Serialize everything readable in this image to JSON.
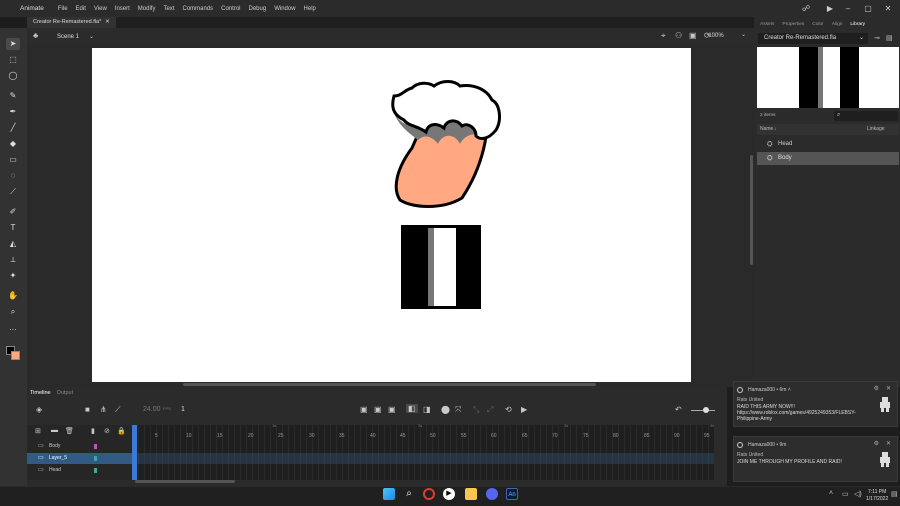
{
  "app": {
    "name": "Animate"
  },
  "menu": [
    "File",
    "Edit",
    "View",
    "Insert",
    "Modify",
    "Text",
    "Commands",
    "Control",
    "Debug",
    "Window",
    "Help"
  ],
  "document": {
    "tab_label": "Creator Re-Remastered.fla*",
    "scene": "Scene 1",
    "zoom": "100%"
  },
  "right_panel": {
    "tabs": [
      "Assets",
      "Properties",
      "Color",
      "Align",
      "Library"
    ],
    "active_tab": "Library",
    "library_file": "Creator Re-Remastered.fla",
    "items_count": "2 items",
    "col_name": "Name",
    "col_linkage": "Linkage",
    "items": [
      {
        "label": "Head",
        "selected": false
      },
      {
        "label": "Body",
        "selected": true
      }
    ]
  },
  "timeline": {
    "tabs": [
      "Timeline",
      "Output"
    ],
    "fps": "24.00",
    "fps_unit": "FPS",
    "frame": "1",
    "layers": [
      {
        "label": "Body",
        "selected": false
      },
      {
        "label": "Layer_5",
        "selected": true
      },
      {
        "label": "Head",
        "selected": false
      }
    ],
    "ruler": [
      "5",
      "10",
      "15",
      "20",
      "25",
      "30",
      "35",
      "40",
      "45",
      "50",
      "55",
      "60",
      "65",
      "70",
      "75",
      "80",
      "85",
      "90",
      "95"
    ],
    "seconds": [
      "1s",
      "2s",
      "3s",
      "4s"
    ]
  },
  "notifications": [
    {
      "user": "Hamaza000",
      "time": "6m",
      "title": "Rats United",
      "message": "RAID THIS ARMY NOW!!! https://www.roblox.com/games/4925249353/FLEBSY-Philippine-Army"
    },
    {
      "user": "Hamaza000",
      "time": "9m",
      "title": "Rats United",
      "message": "JOIN ME THROUGH MY PROFILE AND RAID!"
    }
  ],
  "clock": {
    "time": "7:11 PM",
    "date": "1/17/2022"
  },
  "colors": {
    "accent": "#3b7bd6",
    "skin": "#ffa882",
    "layer_magenta": "#c054c4",
    "selected_layer": "#325a84"
  }
}
